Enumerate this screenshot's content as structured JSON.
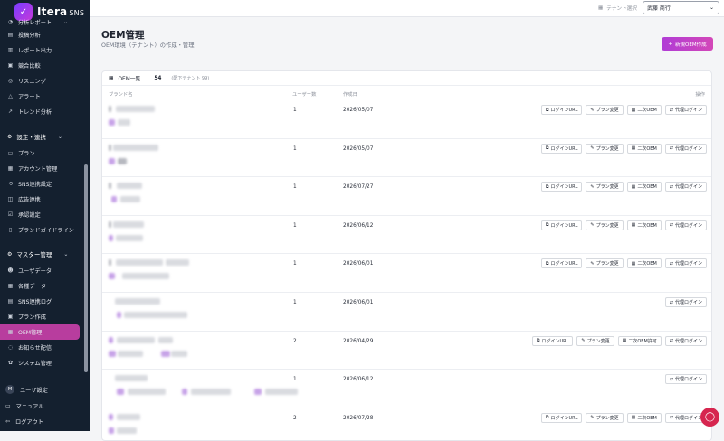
{
  "app": {
    "name": "Itera",
    "suffix": "SNS"
  },
  "sidebar": {
    "pre_items": [
      {
        "label": "分析レポート",
        "icon": "chart-icon",
        "chev": "⌄"
      },
      {
        "label": "投稿分析",
        "icon": "post-icon"
      },
      {
        "label": "レポート出力",
        "icon": "report-icon"
      },
      {
        "label": "競合比較",
        "icon": "compare-icon"
      },
      {
        "label": "リスニング",
        "icon": "ear-icon"
      },
      {
        "label": "アラート",
        "icon": "alert-icon"
      },
      {
        "label": "トレンド分析",
        "icon": "trend-icon"
      }
    ],
    "group_settings": "設定・連携",
    "settings_items": [
      {
        "label": "プラン",
        "icon": "plan-icon"
      },
      {
        "label": "アカウント管理",
        "icon": "account-icon"
      },
      {
        "label": "SNS連携設定",
        "icon": "link-icon"
      },
      {
        "label": "広告連携",
        "icon": "ad-icon"
      },
      {
        "label": "承認設定",
        "icon": "approve-icon"
      },
      {
        "label": "ブランドガイドライン",
        "icon": "book-icon"
      }
    ],
    "group_master": "マスター管理",
    "master_items": [
      {
        "label": "ユーザデータ",
        "icon": "users-icon"
      },
      {
        "label": "各種データ",
        "icon": "data-icon"
      },
      {
        "label": "SNS連携ログ",
        "icon": "log-icon"
      },
      {
        "label": "プラン作成",
        "icon": "plan-create-icon"
      },
      {
        "label": "OEM管理",
        "icon": "oem-icon",
        "active": true
      },
      {
        "label": "お知らせ配信",
        "icon": "bell-icon"
      },
      {
        "label": "システム管理",
        "icon": "gear-icon"
      }
    ],
    "user_settings": "ユーザ設定",
    "avatar_initial": "M",
    "manual": "マニュアル",
    "logout": "ログアウト"
  },
  "topbar": {
    "tenant_label": "テナント選択",
    "tenant_value": "武藤 商行"
  },
  "page": {
    "title": "OEM管理",
    "subtitle": "OEM環境（テナント）の作成・管理",
    "new_button": "新規OEM作成"
  },
  "table": {
    "heading": "OEM一覧",
    "count": "54",
    "sub": "(配下テナント 99)",
    "columns": {
      "brand": "ブランド名",
      "users": "ユーザー数",
      "created": "作成日",
      "actions": "操作"
    },
    "labels": {
      "login_url": "ログインURL",
      "plan_change": "プラン変更",
      "secondary_oem": "二次OEM",
      "secondary_oem_allow": "二次OEM許可",
      "proxy_login": "代理ログイン"
    },
    "rows": [
      {
        "users": "1",
        "created": "2026/05/07",
        "actions": "full"
      },
      {
        "users": "1",
        "created": "2026/05/07",
        "actions": "full"
      },
      {
        "users": "1",
        "created": "2026/07/27",
        "actions": "full"
      },
      {
        "users": "1",
        "created": "2026/06/12",
        "actions": "full"
      },
      {
        "users": "1",
        "created": "2026/06/01",
        "actions": "full"
      },
      {
        "users": "1",
        "created": "2026/06/01",
        "actions": "proxy"
      },
      {
        "users": "2",
        "created": "2026/04/29",
        "actions": "allow"
      },
      {
        "users": "1",
        "created": "2026/06/12",
        "actions": "proxy"
      },
      {
        "users": "2",
        "created": "2026/07/28",
        "actions": "full"
      }
    ]
  },
  "colors": {
    "sidebar": "#14202f",
    "accent": "#b83d9e",
    "chat": "#d6264f"
  }
}
